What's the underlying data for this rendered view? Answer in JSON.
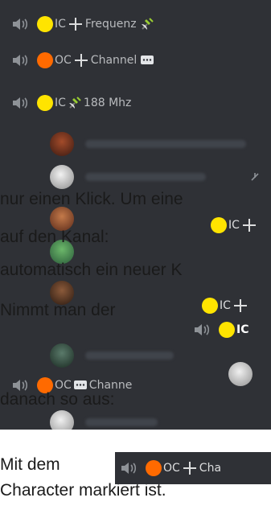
{
  "channels": [
    {
      "prefix": "IC",
      "dot": "#ffe400",
      "sep": "plus",
      "label": "Frequenz",
      "icon": "satellite-icon"
    },
    {
      "prefix": "OC",
      "dot": "#ff6a00",
      "sep": "plus",
      "label": "Channel",
      "icon": "chat-icon"
    },
    {
      "prefix": "IC",
      "dot": "#ffe400",
      "sep": "satellite",
      "label": "188 Mhz",
      "icon": ""
    }
  ],
  "overlays": {
    "ic1": {
      "prefix": "IC"
    },
    "ic2": {
      "prefix": "IC"
    },
    "ic3": {
      "prefix": "IC"
    },
    "oc_channel": {
      "prefix": "OC",
      "label": "Channe"
    },
    "oc_bottom": {
      "prefix": "OC",
      "label": "Cha"
    }
  },
  "article_text": {
    "line1": "nur einen Klick. Um eine",
    "line2": "auf den Kanal:",
    "line3": "automatisch ein neuer K",
    "line4": "Nimmt man der",
    "line5": "danach so aus:",
    "line6": "Mit dem",
    "line7": "Character markiert ist."
  },
  "colors": {
    "dark_bg": "#2f3136",
    "ic_dot": "#ffe400",
    "oc_dot": "#ff6a00",
    "channel_text": "#b9bbbe"
  }
}
